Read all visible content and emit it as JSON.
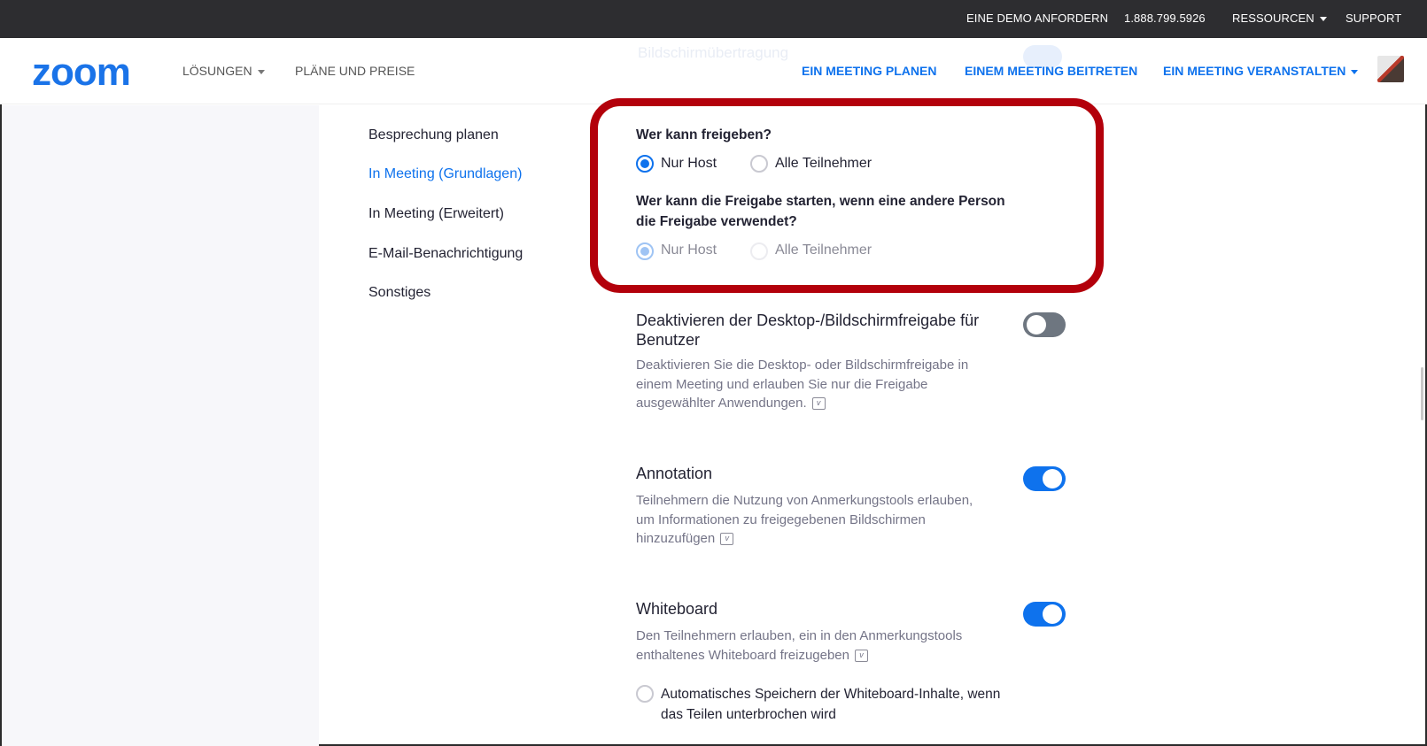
{
  "topbar": {
    "demo": "EINE DEMO ANFORDERN",
    "phone": "1.888.799.5926",
    "resources": "RESSOURCEN",
    "support": "SUPPORT"
  },
  "header": {
    "logo": "zoom",
    "solutions": "LÖSUNGEN",
    "plans": "PLÄNE UND PREISE",
    "schedule": "EIN MEETING PLANEN",
    "join": "EINEM MEETING BEITRETEN",
    "host": "EIN MEETING VERANSTALTEN",
    "ghost_title": "Bildschirmübertragung"
  },
  "sidebar": {
    "items": [
      {
        "label": "Besprechung planen",
        "active": false
      },
      {
        "label": "In Meeting (Grundlagen)",
        "active": true
      },
      {
        "label": "In Meeting (Erweitert)",
        "active": false
      },
      {
        "label": "E-Mail-Benachrichtigung",
        "active": false
      },
      {
        "label": "Sonstiges",
        "active": false
      }
    ]
  },
  "sharing": {
    "who_can_share": "Wer kann freigeben?",
    "who_can_share_options": {
      "host_only": "Nur Host",
      "all": "Alle Teilnehmer",
      "selected": "host_only"
    },
    "who_can_start_line1": "Wer kann die Freigabe starten, wenn eine andere Person",
    "who_can_start_line2": "die Freigabe verwendet?",
    "who_can_start_options": {
      "host_only": "Nur Host",
      "all": "Alle Teilnehmer",
      "selected": "host_only",
      "disabled": true
    }
  },
  "settings": {
    "disable_desktop": {
      "title_line1": "Deaktivieren der Desktop-/Bildschirmfreigabe für",
      "title_line2": "Benutzer",
      "desc_line1": "Deaktivieren Sie die Desktop- oder Bildschirmfreigabe in",
      "desc_line2": "einem Meeting und erlauben Sie nur die Freigabe",
      "desc_line3": "ausgewählter Anwendungen.",
      "enabled": false
    },
    "annotation": {
      "title": "Annotation",
      "desc_line1": "Teilnehmern die Nutzung von Anmerkungstools erlauben,",
      "desc_line2": "um Informationen zu freigegebenen Bildschirmen",
      "desc_line3": "hinzuzufügen",
      "enabled": true
    },
    "whiteboard": {
      "title": "Whiteboard",
      "desc_line1": "Den Teilnehmern erlauben, ein in den Anmerkungstools",
      "desc_line2": "enthaltenes Whiteboard freizugeben",
      "enabled": true,
      "autosave_line1": "Automatisches Speichern der Whiteboard-Inhalte, wenn",
      "autosave_line2": "das Teilen unterbrochen wird",
      "autosave_checked": false
    }
  },
  "colors": {
    "accent": "#0e72ed",
    "highlight": "#b3000b",
    "topbar": "#2d2d30"
  }
}
